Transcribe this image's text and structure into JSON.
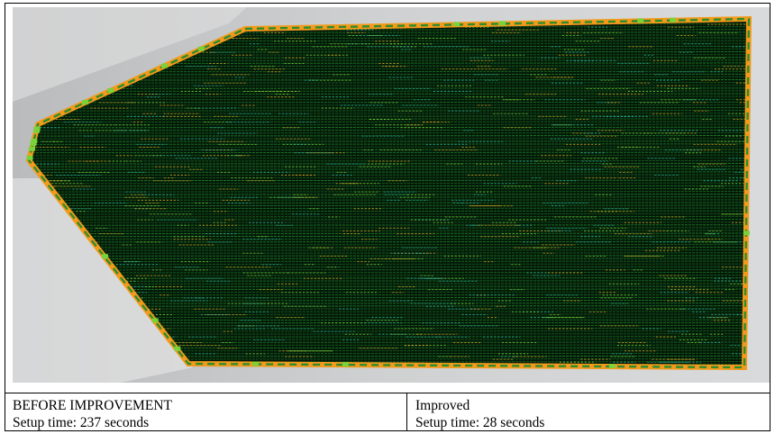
{
  "map": {
    "background_color": "#c9cbcd",
    "field_color": "#041a08",
    "row_color": "#1f7a2a",
    "boundary_color": "#f39a1a",
    "boundary_dash_color": "#2e8b2e",
    "accent_colors": [
      "#e0a020",
      "#2bb3a3",
      "#7ad13a"
    ]
  },
  "captions": {
    "before": {
      "title": "BEFORE IMPROVEMENT",
      "setup": "Setup time: 237 seconds"
    },
    "after": {
      "title": "Improved",
      "setup": "Setup time: 28 seconds"
    }
  }
}
